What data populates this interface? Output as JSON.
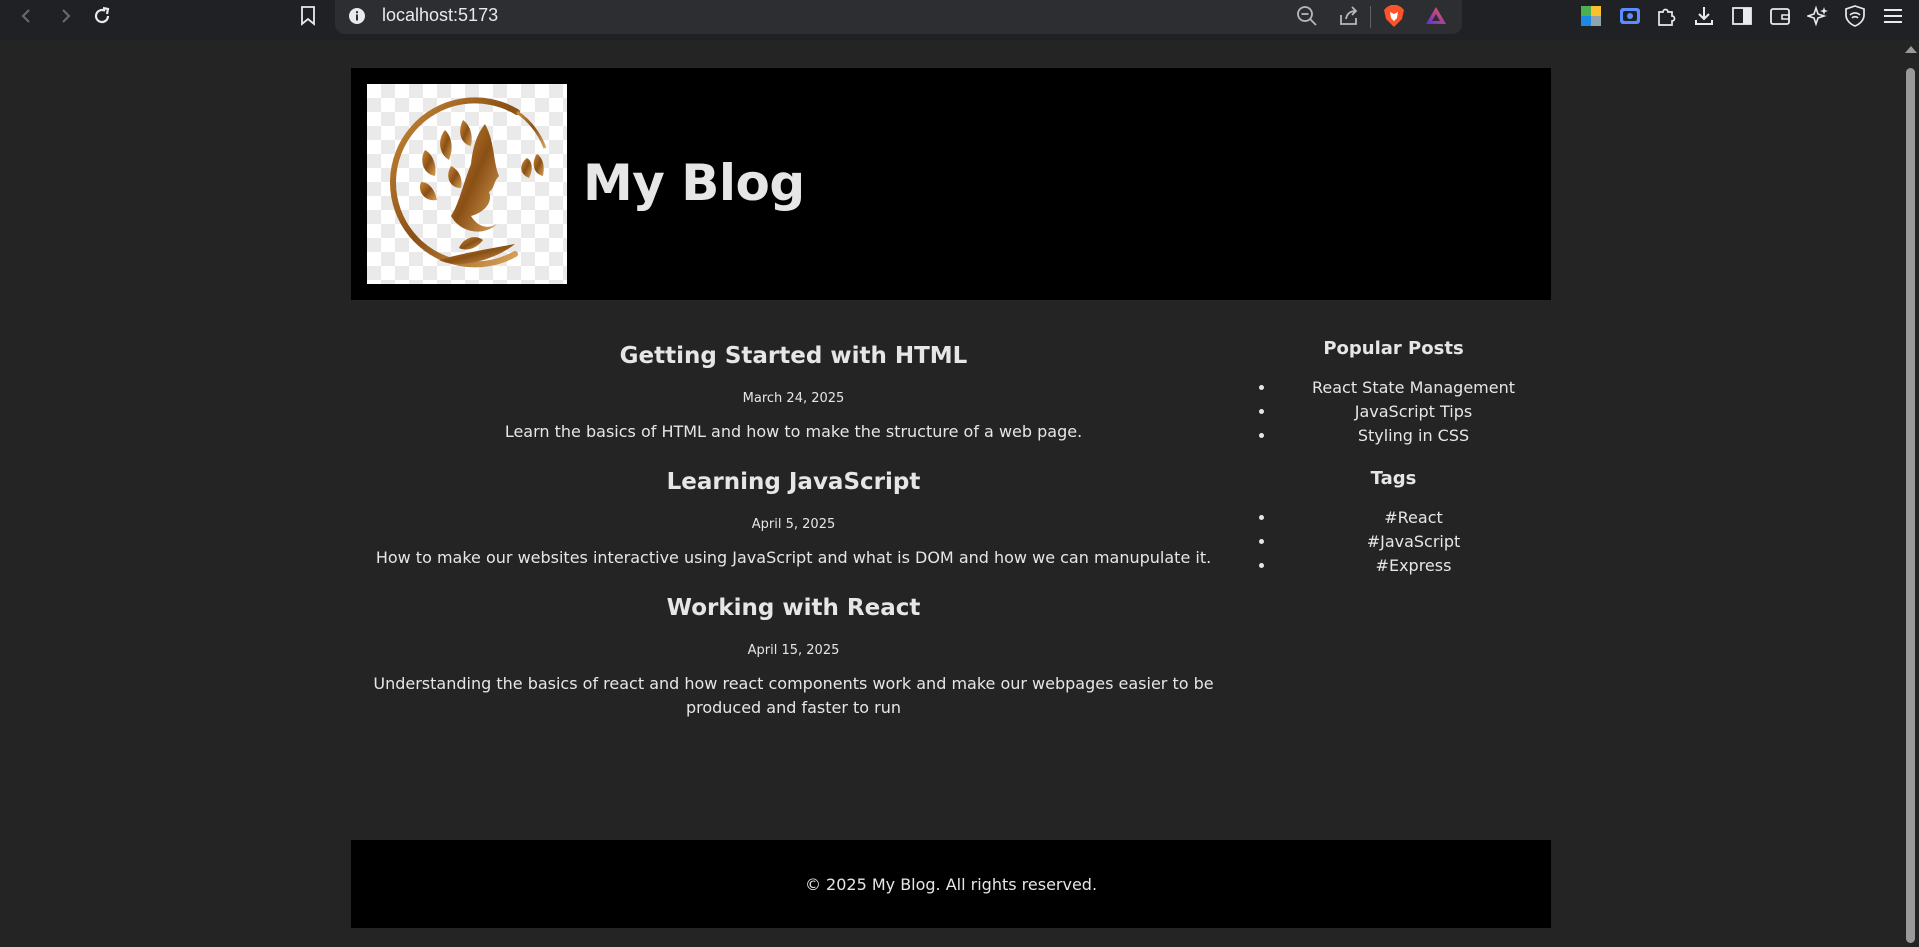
{
  "browser": {
    "url": "localhost:5173",
    "icons": {
      "back": "arrow-left-icon",
      "forward": "arrow-right-icon",
      "reload": "reload-icon",
      "bookmark": "bookmark-icon",
      "site_info": "info-icon",
      "zoom": "zoom-out-icon",
      "share": "share-icon",
      "brave": "brave-shield-icon",
      "rewards": "brave-rewards-icon"
    },
    "extensions": [
      "translate-icon",
      "screencast-icon",
      "puzzle-icon",
      "download-icon",
      "sidebar-icon",
      "wallet-icon",
      "leo-ai-icon",
      "vpn-icon",
      "menu-icon"
    ]
  },
  "header": {
    "title": "My Blog",
    "logo_alt": "logo"
  },
  "posts": [
    {
      "title": "Getting Started with HTML",
      "date": "March 24, 2025",
      "summary": "Learn the basics of HTML and how to make the structure of a web page."
    },
    {
      "title": "Learning JavaScript",
      "date": "April 5, 2025",
      "summary": "How to make our websites interactive using JavaScript and what is DOM and how we can manupulate it."
    },
    {
      "title": "Working with React",
      "date": "April 15, 2025",
      "summary": "Understanding the basics of react and how react components work and make our webpages easier to be produced and faster to run"
    }
  ],
  "sidebar": {
    "popular_heading": "Popular Posts",
    "popular": [
      "React State Management",
      "JavaScript Tips",
      "Styling in CSS"
    ],
    "tags_heading": "Tags",
    "tags": [
      "#React",
      "#JavaScript",
      "#Express"
    ]
  },
  "footer": {
    "text": "© 2025 My Blog. All rights reserved."
  },
  "colors": {
    "page_bg": "#242424",
    "header_bg": "#000000",
    "text": "#e6e6e6",
    "logo_gold": "#a0621c"
  }
}
